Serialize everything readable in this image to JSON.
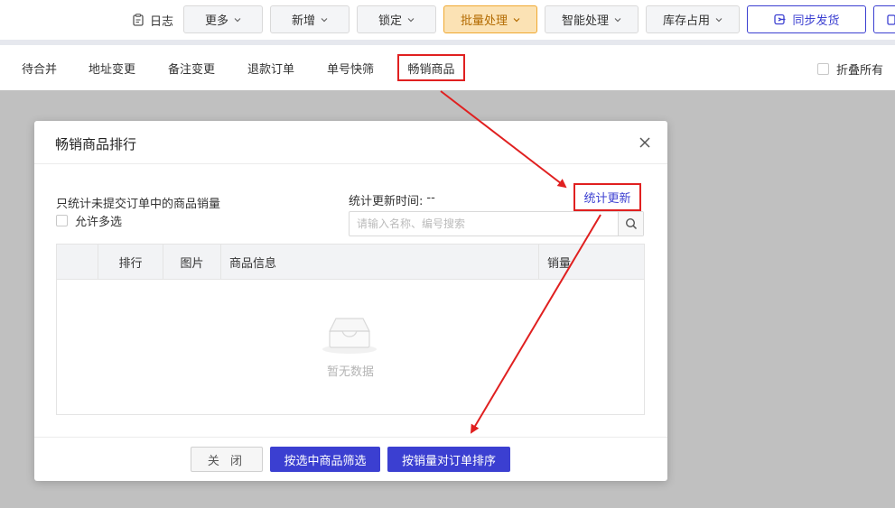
{
  "toolbar": {
    "log_label": "日志",
    "buttons": [
      {
        "label": "更多"
      },
      {
        "label": "新增"
      },
      {
        "label": "锁定"
      },
      {
        "label": "批量处理"
      },
      {
        "label": "智能处理"
      },
      {
        "label": "库存占用"
      },
      {
        "label": "同步发货"
      }
    ]
  },
  "tabs": [
    "待合并",
    "地址变更",
    "备注变更",
    "退款订单",
    "单号快筛",
    "畅销商品"
  ],
  "fold_all_label": "折叠所有",
  "modal": {
    "title": "畅销商品排行",
    "note": "只统计未提交订单中的商品销量",
    "allow_multi_label": "允许多选",
    "update_time_label": "统计更新时间:",
    "update_time_value": "--",
    "refresh_label": "统计更新",
    "search_placeholder": "请输入名称、编号搜索",
    "columns": [
      "排行",
      "图片",
      "商品信息",
      "销量"
    ],
    "empty_text": "暂无数据",
    "footer": {
      "close_label": "关 闭",
      "filter_label": "按选中商品筛选",
      "sort_label": "按销量对订单排序"
    }
  },
  "colors": {
    "primary": "#3b3fd1",
    "highlight": "#e02020",
    "batch_bg": "#fbe2b4",
    "batch_text": "#b36b00"
  }
}
